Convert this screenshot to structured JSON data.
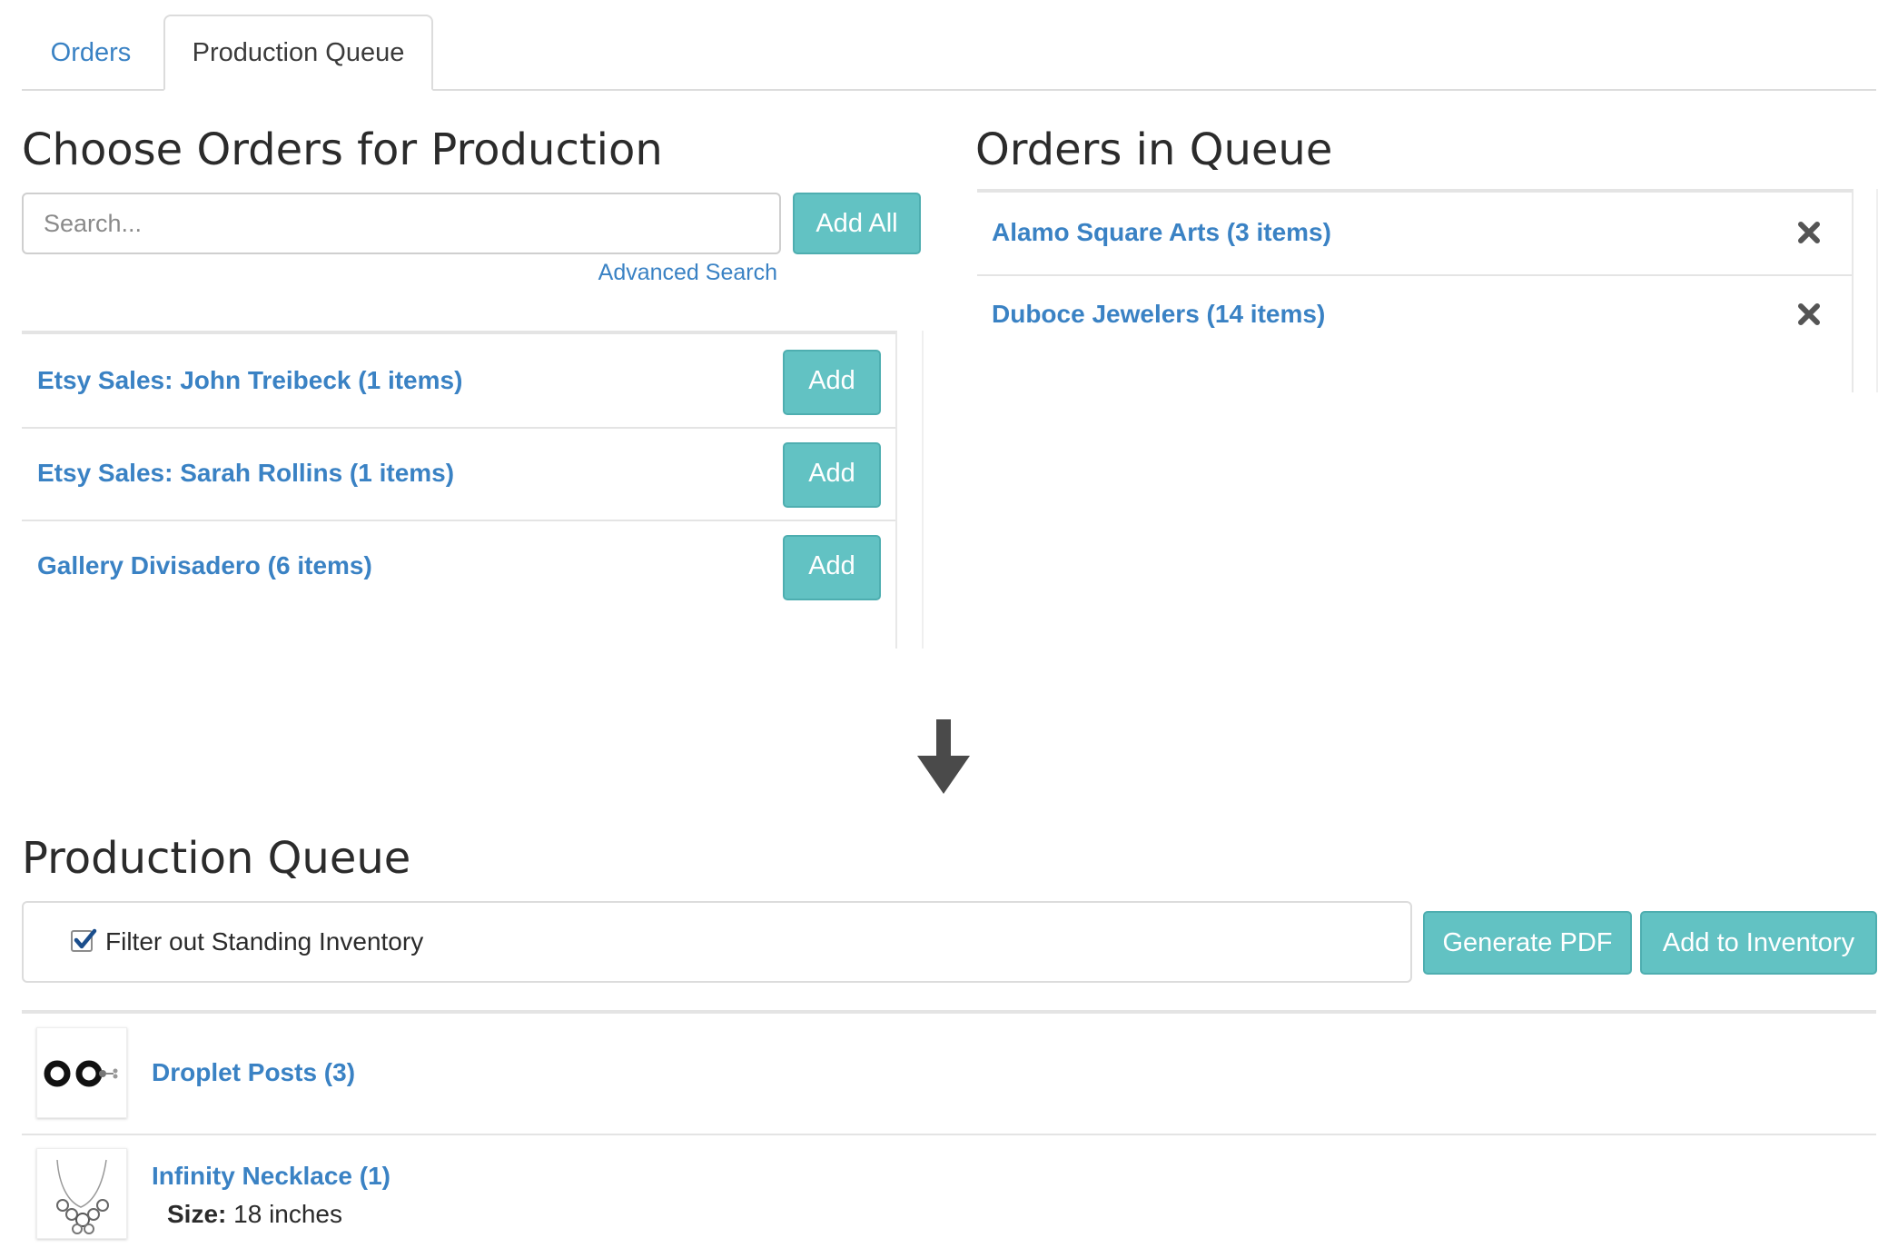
{
  "tabs": [
    {
      "label": "Orders",
      "active": false
    },
    {
      "label": "Production Queue",
      "active": true
    }
  ],
  "choose": {
    "heading": "Choose Orders for Production",
    "search_placeholder": "Search...",
    "add_all_label": "Add All",
    "advanced_search_label": "Advanced Search",
    "orders": [
      {
        "label": "Etsy Sales: John Treibeck (1 items)",
        "button": "Add"
      },
      {
        "label": "Etsy Sales: Sarah Rollins (1 items)",
        "button": "Add"
      },
      {
        "label": "Gallery Divisadero (6 items)",
        "button": "Add"
      }
    ]
  },
  "queue": {
    "heading": "Orders in Queue",
    "items": [
      {
        "label": "Alamo Square Arts (3 items)"
      },
      {
        "label": "Duboce Jewelers (14 items)"
      }
    ]
  },
  "production": {
    "heading": "Production Queue",
    "filter_label": "Filter out Standing Inventory",
    "filter_checked": true,
    "generate_pdf_label": "Generate PDF",
    "add_inventory_label": "Add to Inventory",
    "products": [
      {
        "name": "Droplet Posts (3)",
        "thumb_icon": "earring-thumbnail"
      },
      {
        "name": "Infinity Necklace (1)",
        "thumb_icon": "necklace-thumbnail",
        "size_label": "Size:",
        "size_value": " 18 inches"
      }
    ]
  },
  "colors": {
    "link": "#3a82c4",
    "button": "#62c2c3",
    "button_border": "#4eaeb0",
    "divider": "#e4e4e4"
  }
}
